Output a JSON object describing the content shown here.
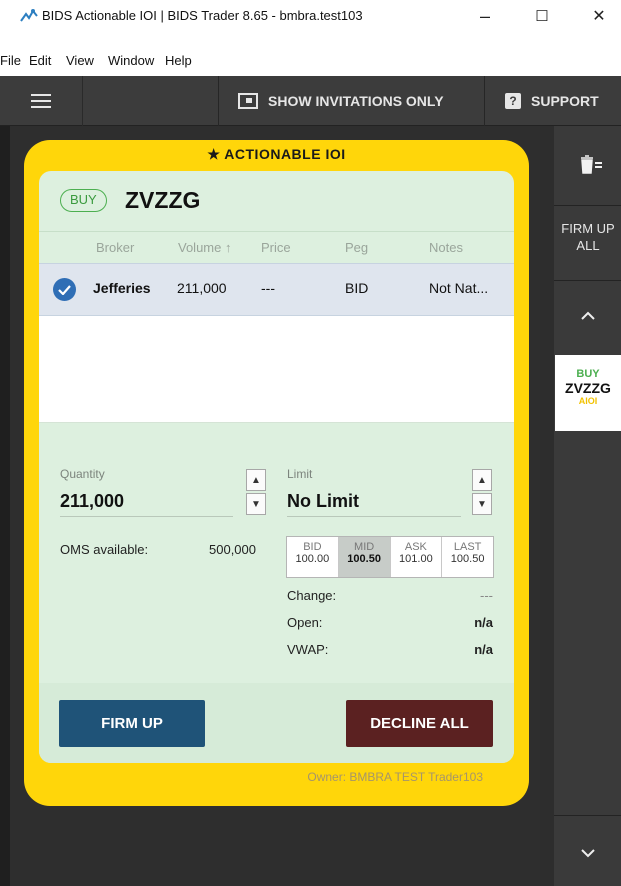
{
  "window": {
    "title": "BIDS Actionable IOI | BIDS Trader 8.65 - bmbra.test103",
    "minimize": "–",
    "maximize": "☐",
    "close": "✕"
  },
  "menu": [
    "File",
    "Edit",
    "View",
    "Window",
    "Help"
  ],
  "toolbar": {
    "show_invitations": "SHOW INVITATIONS ONLY",
    "support": "SUPPORT",
    "support_badge": "?"
  },
  "card": {
    "header": "★ ACTIONABLE IOI",
    "side": "BUY",
    "symbol": "ZVZZG",
    "columns": {
      "broker": "Broker",
      "volume": "Volume ↑",
      "price": "Price",
      "peg": "Peg",
      "notes": "Notes"
    },
    "rows": [
      {
        "broker": "Jefferies",
        "volume": "211,000",
        "price": "---",
        "peg": "BID",
        "notes": "Not Nat..."
      }
    ],
    "quantity_label": "Quantity",
    "quantity_value": "211,000",
    "limit_label": "Limit",
    "limit_value": "No Limit",
    "oms_label": "OMS available:",
    "oms_value": "500,000",
    "quotes": [
      {
        "name": "BID",
        "value": "100.00",
        "selected": false
      },
      {
        "name": "MID",
        "value": "100.50",
        "selected": true
      },
      {
        "name": "ASK",
        "value": "101.00",
        "selected": false
      },
      {
        "name": "LAST",
        "value": "100.50",
        "selected": false
      }
    ],
    "change_label": "Change:",
    "change_value": "---",
    "open_label": "Open:",
    "open_value": "n/a",
    "vwap_label": "VWAP:",
    "vwap_value": "n/a",
    "firm_up": "FIRM UP",
    "decline_all": "DECLINE ALL",
    "owner": "Owner: BMBRA TEST Trader103"
  },
  "sidebar": {
    "firm_up_all": "FIRM UP ALL",
    "mini_side": "BUY",
    "mini_symbol": "ZVZZG",
    "mini_tag": "AIOI"
  },
  "colors": {
    "card_yellow": "#ffd60a",
    "firm_up": "#1f5378",
    "decline_all": "#5b2121",
    "buy_green": "#4caf50"
  }
}
